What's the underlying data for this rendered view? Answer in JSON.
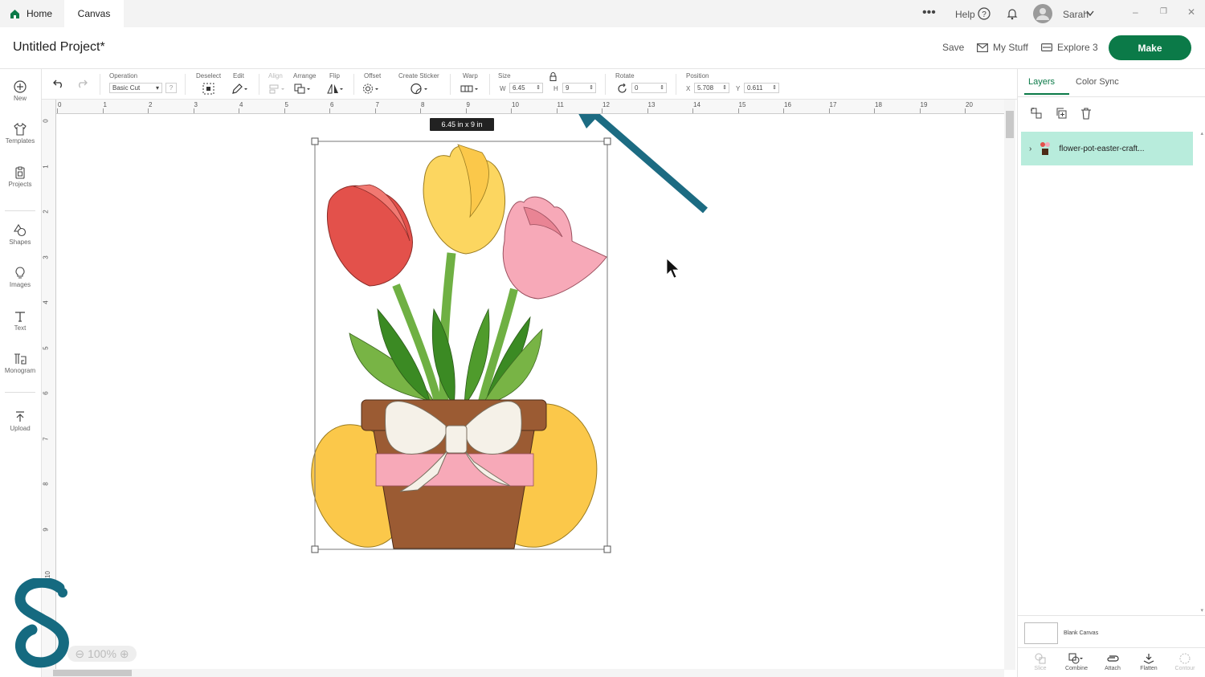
{
  "tabs": {
    "home": "Home",
    "canvas": "Canvas"
  },
  "titlebar": {
    "help": "Help",
    "user": "Sarah"
  },
  "header": {
    "project_title": "Untitled Project*",
    "save": "Save",
    "my_stuff": "My Stuff",
    "machine": "Explore 3",
    "make": "Make"
  },
  "toolbar": {
    "operation_label": "Operation",
    "operation_value": "Basic Cut",
    "deselect": "Deselect",
    "edit": "Edit",
    "align": "Align",
    "arrange": "Arrange",
    "flip": "Flip",
    "offset": "Offset",
    "create_sticker": "Create Sticker",
    "warp": "Warp",
    "size_label": "Size",
    "w_label": "W",
    "w_value": "6.45",
    "h_label": "H",
    "h_value": "9",
    "rotate_label": "Rotate",
    "rotate_value": "0",
    "position_label": "Position",
    "x_label": "X",
    "x_value": "5.708",
    "y_label": "Y",
    "y_value": "0.611"
  },
  "leftrail": {
    "new": "New",
    "templates": "Templates",
    "projects": "Projects",
    "shapes": "Shapes",
    "images": "Images",
    "text": "Text",
    "monogram": "Monogram",
    "upload": "Upload"
  },
  "ruler": {
    "top": [
      "0",
      "1",
      "2",
      "3",
      "4",
      "5",
      "6",
      "7",
      "8",
      "9",
      "10",
      "11",
      "12",
      "13",
      "14",
      "15",
      "16",
      "17",
      "18",
      "19",
      "20"
    ],
    "left": [
      "0",
      "1",
      "2",
      "3",
      "4",
      "5",
      "6",
      "7",
      "8",
      "9",
      "10"
    ]
  },
  "canvas": {
    "size_tooltip": "6.45  in x 9  in",
    "zoom": "100%"
  },
  "rightpanel": {
    "layers_tab": "Layers",
    "color_sync_tab": "Color Sync",
    "layer_name": "flower-pot-easter-craft...",
    "blank_canvas": "Blank Canvas",
    "bottom": {
      "slice": "Slice",
      "combine": "Combine",
      "attach": "Attach",
      "flatten": "Flatten",
      "contour": "Contour"
    }
  },
  "colors": {
    "accent": "#0b7a48",
    "layer_bg": "#b8ecdc",
    "arrow": "#1c6b82"
  }
}
